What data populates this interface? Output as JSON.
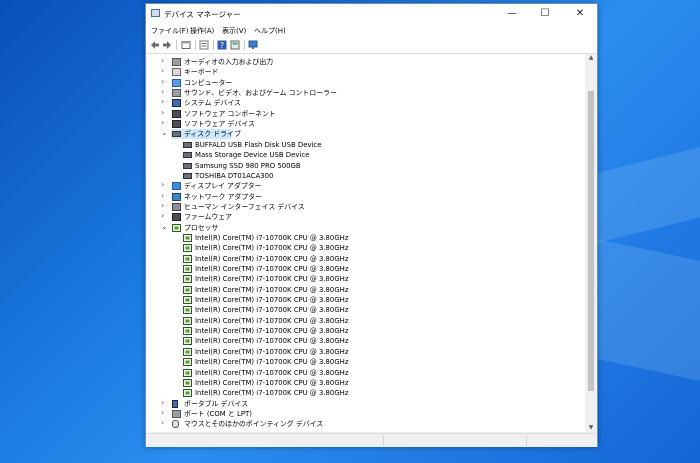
{
  "window": {
    "title": "デバイス マネージャー"
  },
  "window_controls": {
    "minimize": "—",
    "maximize": "☐",
    "close": "✕"
  },
  "menu": [
    {
      "label": "ファイル(F)"
    },
    {
      "label": "操作(A)"
    },
    {
      "label": "表示(V)"
    },
    {
      "label": "ヘルプ(H)"
    }
  ],
  "toolbar": [
    "back-icon",
    "forward-icon",
    "properties-icon",
    "view-icon",
    "help-icon",
    "devices-icon",
    "monitor-icon"
  ],
  "tree": {
    "categories_top": [
      {
        "label": "オーディオの入力および出力",
        "icon": "speaker-icon"
      },
      {
        "label": "キーボード",
        "icon": "keyboard-icon"
      },
      {
        "label": "コンピューター",
        "icon": "computer-icon"
      },
      {
        "label": "サウンド、ビデオ、およびゲーム コントローラー",
        "icon": "speaker-icon"
      },
      {
        "label": "システム デバイス",
        "icon": "folder-icon"
      },
      {
        "label": "ソフトウェア コンポーネント",
        "icon": "chip-icon"
      },
      {
        "label": "ソフトウェア デバイス",
        "icon": "chip-icon"
      }
    ],
    "disk_drives": {
      "label": "ディスク ドライブ",
      "children": [
        "BUFFALO USB Flash Disk USB Device",
        "Mass Storage Device USB Device",
        "Samsung SSD 980 PRO 500GB",
        "TOSHIBA DT01ACA300"
      ]
    },
    "categories_mid": [
      {
        "label": "ディスプレイ アダプター",
        "icon": "monitor-icon"
      },
      {
        "label": "ネットワーク アダプター",
        "icon": "network-icon"
      },
      {
        "label": "ヒューマン インターフェイス デバイス",
        "icon": "hid-icon"
      },
      {
        "label": "ファームウェア",
        "icon": "chip-icon"
      }
    ],
    "processors": {
      "label": "プロセッサ",
      "children": [
        "Intel(R) Core(TM) i7-10700K CPU @ 3.80GHz",
        "Intel(R) Core(TM) i7-10700K CPU @ 3.80GHz",
        "Intel(R) Core(TM) i7-10700K CPU @ 3.80GHz",
        "Intel(R) Core(TM) i7-10700K CPU @ 3.80GHz",
        "Intel(R) Core(TM) i7-10700K CPU @ 3.80GHz",
        "Intel(R) Core(TM) i7-10700K CPU @ 3.80GHz",
        "Intel(R) Core(TM) i7-10700K CPU @ 3.80GHz",
        "Intel(R) Core(TM) i7-10700K CPU @ 3.80GHz",
        "Intel(R) Core(TM) i7-10700K CPU @ 3.80GHz",
        "Intel(R) Core(TM) i7-10700K CPU @ 3.80GHz",
        "Intel(R) Core(TM) i7-10700K CPU @ 3.80GHz",
        "Intel(R) Core(TM) i7-10700K CPU @ 3.80GHz",
        "Intel(R) Core(TM) i7-10700K CPU @ 3.80GHz",
        "Intel(R) Core(TM) i7-10700K CPU @ 3.80GHz",
        "Intel(R) Core(TM) i7-10700K CPU @ 3.80GHz",
        "Intel(R) Core(TM) i7-10700K CPU @ 3.80GHz"
      ]
    },
    "categories_bottom": [
      {
        "label": "ポータブル デバイス",
        "icon": "phone-icon"
      },
      {
        "label": "ポート (COM と LPT)",
        "icon": "port-icon"
      },
      {
        "label": "マウスとそのほかのポインティング デバイス",
        "icon": "mouse-icon"
      }
    ]
  },
  "colors": {
    "selection": "#cce8ff",
    "desktop": "#1a7ae0",
    "title_icon": "#3a6ea5"
  }
}
